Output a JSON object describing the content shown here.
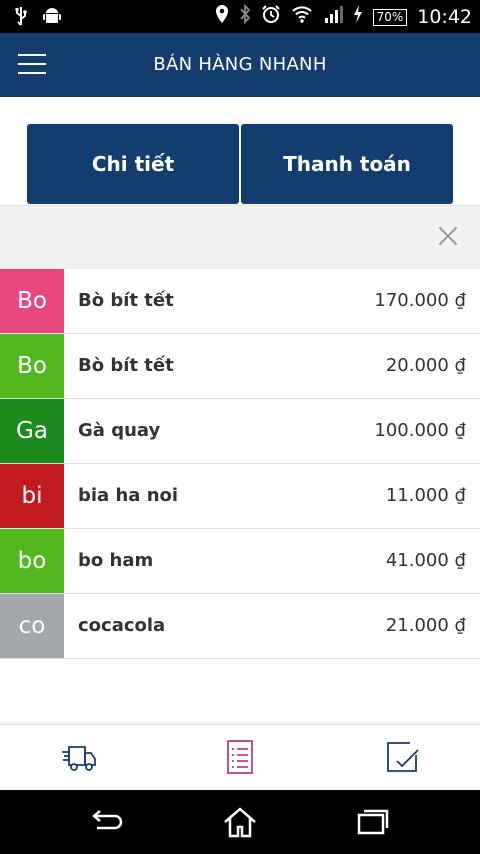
{
  "status_bar": {
    "battery": "70%",
    "time": "10:42",
    "icons": [
      "usb-icon",
      "android-icon",
      "location-icon",
      "bluetooth-icon",
      "alarm-icon",
      "wifi-icon",
      "signal-icon",
      "charging-icon"
    ]
  },
  "appbar": {
    "title": "BÁN HÀNG NHANH"
  },
  "tabs": {
    "detail_label": "Chi tiết",
    "payment_label": "Thanh toán"
  },
  "items": [
    {
      "abbr": "Bo",
      "name": "Bò bít tết",
      "price": "170.000 ₫",
      "color": "#e8477f"
    },
    {
      "abbr": "Bo",
      "name": "Bò bít tết",
      "price": "20.000 ₫",
      "color": "#52b81e"
    },
    {
      "abbr": "Ga",
      "name": "Gà quay",
      "price": "100.000 ₫",
      "color": "#1c8a1c"
    },
    {
      "abbr": "bi",
      "name": "bia ha noi",
      "price": "11.000 ₫",
      "color": "#c21b22"
    },
    {
      "abbr": "bo",
      "name": "bo ham",
      "price": "41.000 ₫",
      "color": "#52b81e"
    },
    {
      "abbr": "co",
      "name": "cocacola",
      "price": "21.000 ₫",
      "color": "#a3a7ab"
    }
  ],
  "bottom_nav": {
    "items": [
      "delivery-truck-icon",
      "order-list-icon",
      "checklist-icon"
    ],
    "active_color": "#c2407a"
  },
  "colors": {
    "primary": "#143d6f"
  }
}
